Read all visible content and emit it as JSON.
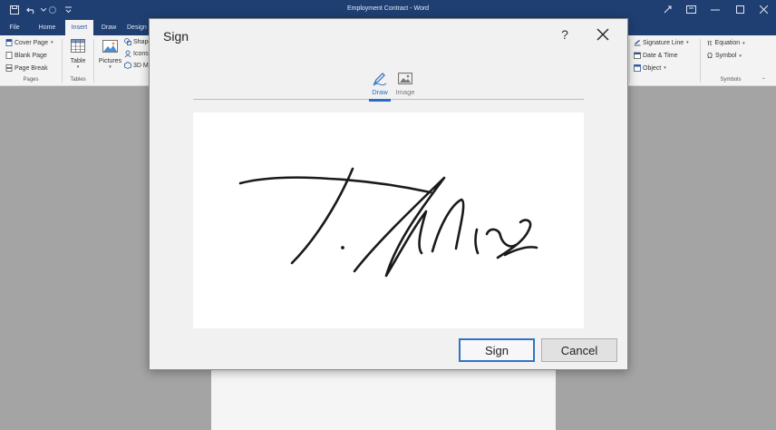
{
  "window": {
    "title": "Employment Contract - Word"
  },
  "tabs": [
    "File",
    "Home",
    "Insert",
    "Draw",
    "Design"
  ],
  "ribbon": {
    "pages_items": [
      "Cover Page",
      "Blank Page",
      "Page Break"
    ],
    "pages_label": "Pages",
    "table_label": "Table",
    "tables_label": "Tables",
    "pictures_label": "Pictures",
    "illustrations_items": [
      "Shapes",
      "Icons",
      "3D Models"
    ],
    "text_items": [
      "Signature Line",
      "Date & Time",
      "Object"
    ],
    "symbols_items": [
      "Equation",
      "Symbol"
    ],
    "symbols_label": "Symbols"
  },
  "dialog": {
    "title": "Sign",
    "help": "?",
    "tabs": {
      "draw": "Draw",
      "image": "Image"
    },
    "sign_button": "Sign",
    "cancel_button": "Cancel"
  },
  "colors": {
    "titlebar": "#1f3f73",
    "accent": "#2b6cc4",
    "sign_border": "#2e74c6"
  }
}
